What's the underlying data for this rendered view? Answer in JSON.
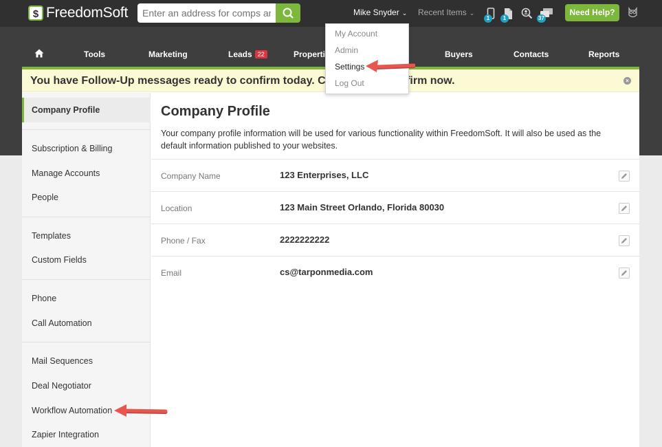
{
  "header": {
    "logo_text": "FreedomSoft",
    "search_placeholder": "Enter an address for comps and",
    "user_name": "Mike Snyder",
    "recent_items": "Recent Items",
    "badges": {
      "phone": "1",
      "docs": "1",
      "messages": "37"
    },
    "need_help": "Need Help?"
  },
  "nav": {
    "items": [
      {
        "label": "Tools"
      },
      {
        "label": "Marketing"
      },
      {
        "label": "Leads",
        "badge": "22"
      },
      {
        "label": "Properties"
      },
      {
        "label": "Buyers"
      },
      {
        "label": "Contacts"
      },
      {
        "label": "Reports"
      }
    ]
  },
  "user_dropdown": {
    "items": [
      "My Account",
      "Admin",
      "Settings",
      "Log Out"
    ]
  },
  "alert": {
    "text": "You have Follow-Up messages ready to confirm today. Click here to confirm now."
  },
  "sidebar": {
    "items": [
      "Company Profile",
      "Subscription & Billing",
      "Manage Accounts",
      "People",
      "Templates",
      "Custom Fields",
      "Phone",
      "Call Automation",
      "Mail Sequences",
      "Deal Negotiator",
      "Workflow Automation",
      "Zapier Integration"
    ]
  },
  "main": {
    "title": "Company Profile",
    "description": "Your company profile information will be used for various functionality within FreedomSoft. It will also be used as the default information published to your websites.",
    "fields": [
      {
        "label": "Company Name",
        "value": "123 Enterprises, LLC"
      },
      {
        "label": "Location",
        "value": "123 Main Street Orlando, Florida 80030"
      },
      {
        "label": "Phone / Fax",
        "value": "2222222222"
      },
      {
        "label": "Email",
        "value": "cs@tarponmedia.com"
      }
    ]
  },
  "colors": {
    "brand_green": "#7bb83c",
    "annotation_arrow": "#e8574f"
  }
}
